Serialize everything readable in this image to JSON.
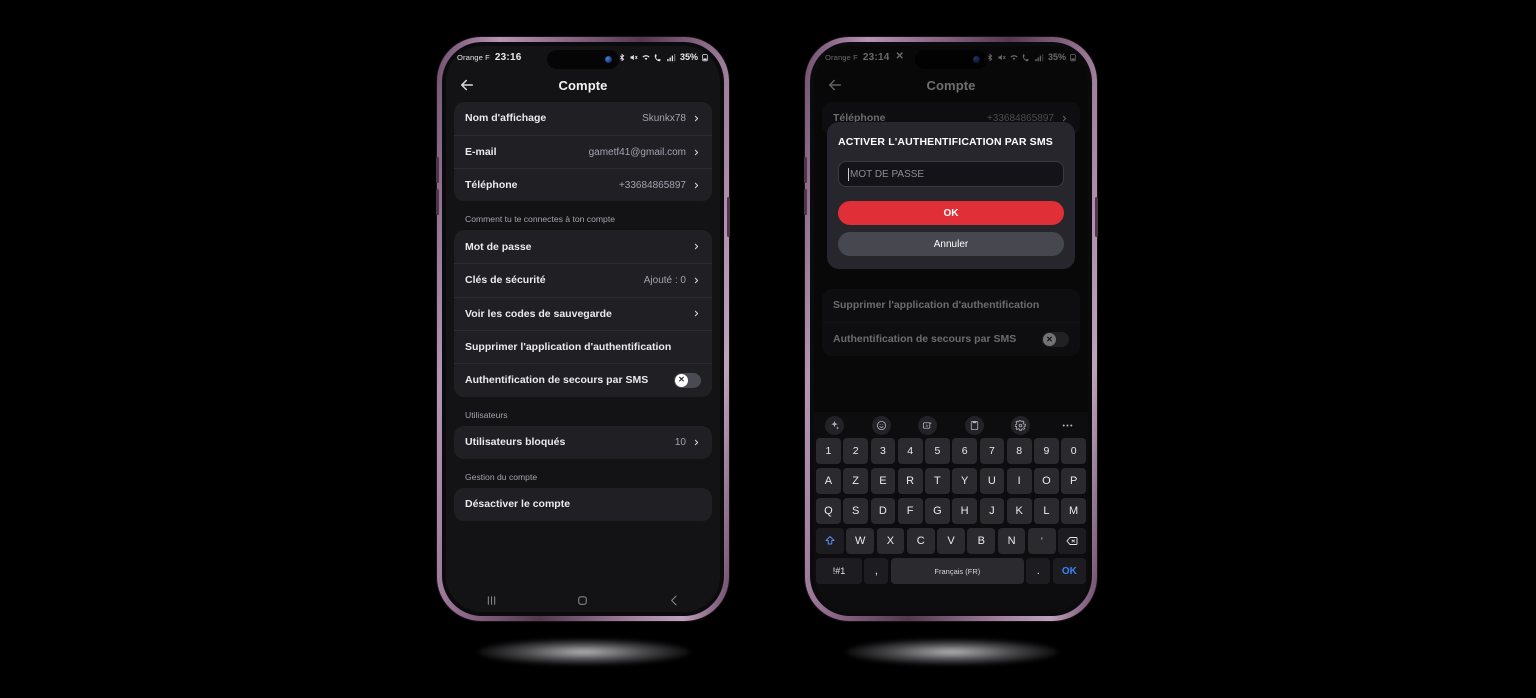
{
  "left_phone": {
    "status_bar": {
      "carrier": "Orange F",
      "time": "23:16",
      "battery_percent": "35%",
      "icons": [
        "alarm-icon",
        "bluetooth-icon",
        "mute-icon",
        "wifi-icon",
        "volte-icon",
        "signal-icon",
        "battery-icon"
      ]
    },
    "header": {
      "title": "Compte",
      "back_icon": "back-arrow-icon"
    },
    "rows_top": [
      {
        "label": "Nom d'affichage",
        "value": "Skunkx78",
        "chevron": true
      },
      {
        "label": "E-mail",
        "value": "gametf41@gmail.com",
        "chevron": true
      },
      {
        "label": "Téléphone",
        "value": "+33684865897",
        "chevron": true
      }
    ],
    "section_login": "Comment tu te connectes à ton compte",
    "rows_login": [
      {
        "label": "Mot de passe",
        "value": "",
        "chevron": true
      },
      {
        "label": "Clés de sécurité",
        "value": "Ajouté : 0",
        "chevron": true
      },
      {
        "label": "Voir les codes de sauvegarde",
        "value": "",
        "chevron": true
      },
      {
        "label": "Supprimer l'application d'authentification",
        "value": "",
        "chevron": false
      },
      {
        "label": "Authentification de secours par SMS",
        "value": "",
        "chevron": false,
        "toggle": "off",
        "toggle_glyph": "✕"
      }
    ],
    "section_users": "Utilisateurs",
    "rows_users": [
      {
        "label": "Utilisateurs bloqués",
        "value": "10",
        "chevron": true
      }
    ],
    "section_management": "Gestion du compte",
    "rows_management": [
      {
        "label": "Désactiver le compte",
        "value": "",
        "chevron": false
      }
    ],
    "navbar": {
      "recents": "recents-icon",
      "home": "home-icon",
      "back": "back-icon"
    }
  },
  "right_phone": {
    "status_bar": {
      "carrier": "Orange F",
      "time": "23:14",
      "x_app": "✕",
      "battery_percent": "35%"
    },
    "header": {
      "title": "Compte",
      "back_icon": "back-arrow-icon"
    },
    "background_rows": [
      {
        "label": "Téléphone",
        "value": "+33684865897"
      },
      {
        "label": "Supprimer l'application d'authentification",
        "value": ""
      },
      {
        "label": "Authentification de secours par SMS",
        "value": "",
        "toggle_glyph": "✕"
      }
    ],
    "dialog": {
      "title": "ACTIVER L'AUTHENTIFICATION PAR SMS",
      "input_placeholder": "MOT DE PASSE",
      "input_value": "",
      "ok_label": "OK",
      "cancel_label": "Annuler",
      "ok_color": "#e02f36"
    },
    "keyboard": {
      "toolbar_icons": [
        "ai-sparkle-icon",
        "emoji-icon",
        "ai-image-icon",
        "clipboard-icon",
        "gear-icon",
        "more-icon"
      ],
      "row_numbers": [
        "1",
        "2",
        "3",
        "4",
        "5",
        "6",
        "7",
        "8",
        "9",
        "0"
      ],
      "row_1": [
        "A",
        "Z",
        "E",
        "R",
        "T",
        "Y",
        "U",
        "I",
        "O",
        "P"
      ],
      "row_2": [
        "Q",
        "S",
        "D",
        "F",
        "G",
        "H",
        "J",
        "K",
        "L",
        "M"
      ],
      "row_3_keys": [
        "W",
        "X",
        "C",
        "V",
        "B",
        "N",
        "'"
      ],
      "shift_icon": "shift-icon",
      "backspace_icon": "backspace-icon",
      "symbols_label": "!#1",
      "comma_label": ",",
      "space_label": "Français (FR)",
      "period_label": ".",
      "ok_label": "OK"
    },
    "navbar": {
      "mic": "mic-icon",
      "recents": "recents-icon",
      "home": "home-icon",
      "hide": "chevron-down-icon"
    }
  }
}
